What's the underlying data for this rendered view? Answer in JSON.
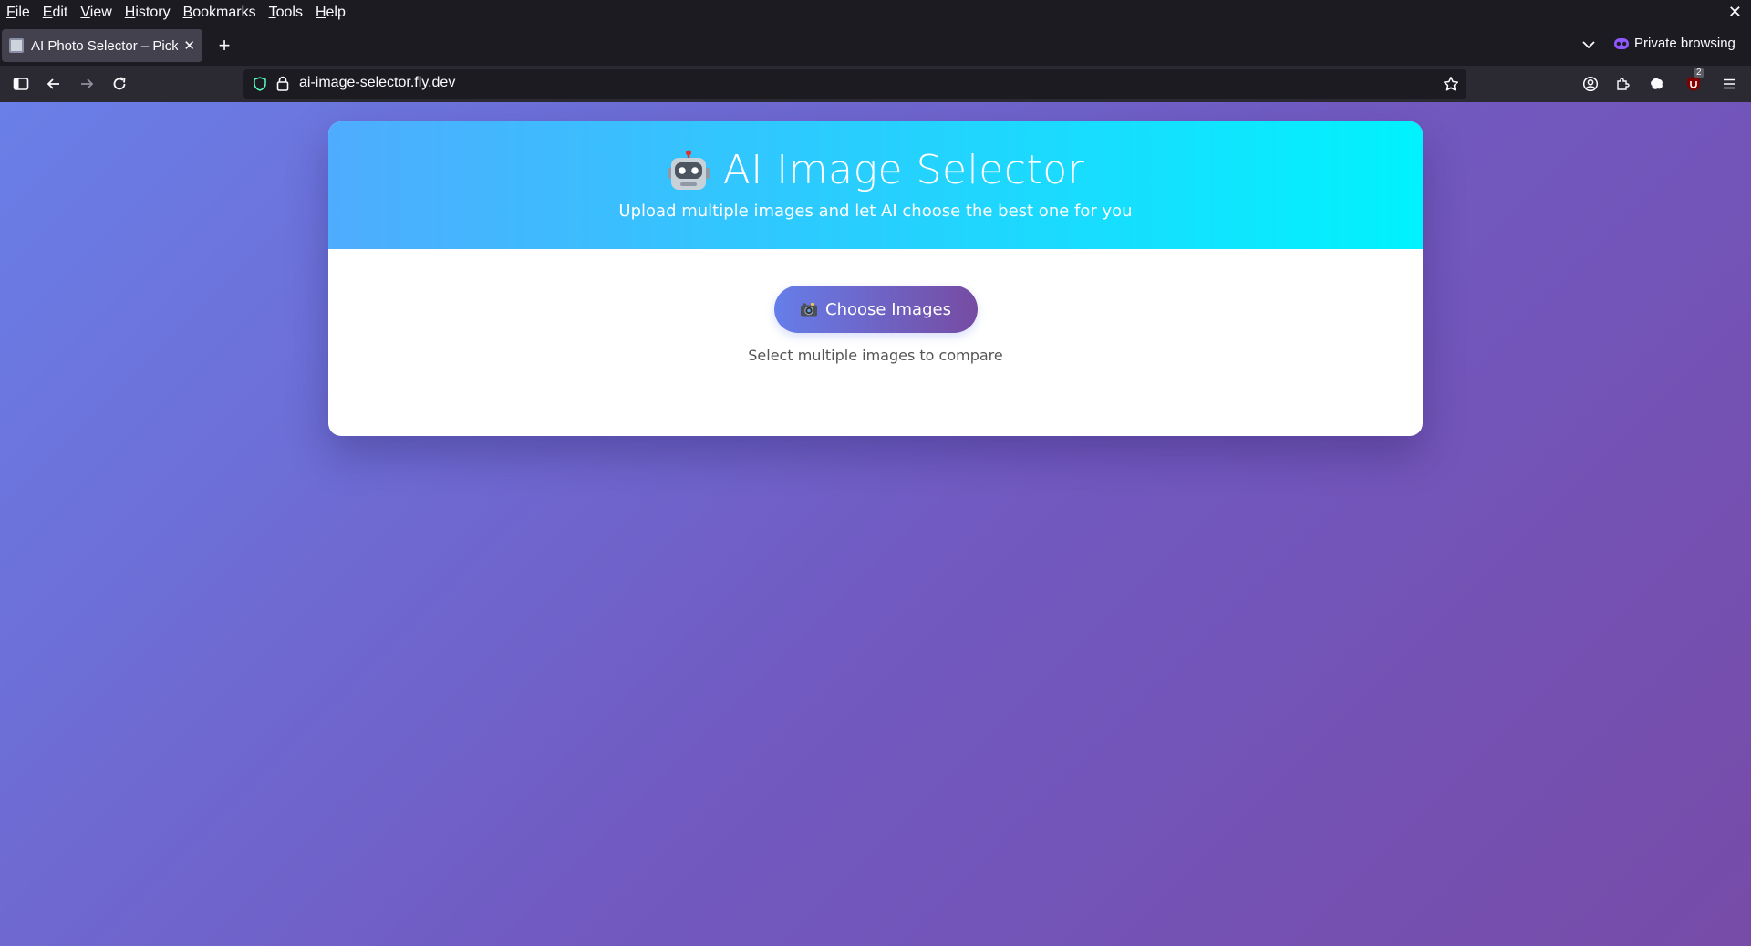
{
  "menubar": {
    "items": [
      {
        "accel": "F",
        "rest": "ile"
      },
      {
        "accel": "E",
        "rest": "dit"
      },
      {
        "accel": "V",
        "rest": "iew"
      },
      {
        "accel": "H",
        "rest": "istory"
      },
      {
        "accel": "B",
        "rest": "ookmarks"
      },
      {
        "accel": "T",
        "rest": "ools"
      },
      {
        "accel": "H",
        "rest": "elp"
      }
    ],
    "close": "✕"
  },
  "tabs": [
    {
      "title": "AI Photo Selector – Pick",
      "close": "✕"
    }
  ],
  "tabbar": {
    "new_tab": "+",
    "private_label": "Private browsing"
  },
  "navbar": {
    "url": "ai-image-selector.fly.dev",
    "extension_badge": "2"
  },
  "page": {
    "title": "AI Image Selector",
    "subtitle": "Upload multiple images and let AI choose the best one for you",
    "button_label": "Choose Images",
    "helper_text": "Select multiple images to compare"
  },
  "colors": {
    "header_gradient": [
      "#4facfe",
      "#00f2fe"
    ],
    "button_gradient": [
      "#667eea",
      "#764ba2"
    ],
    "page_background": [
      "#6a7fe8",
      "#774ba8"
    ]
  }
}
